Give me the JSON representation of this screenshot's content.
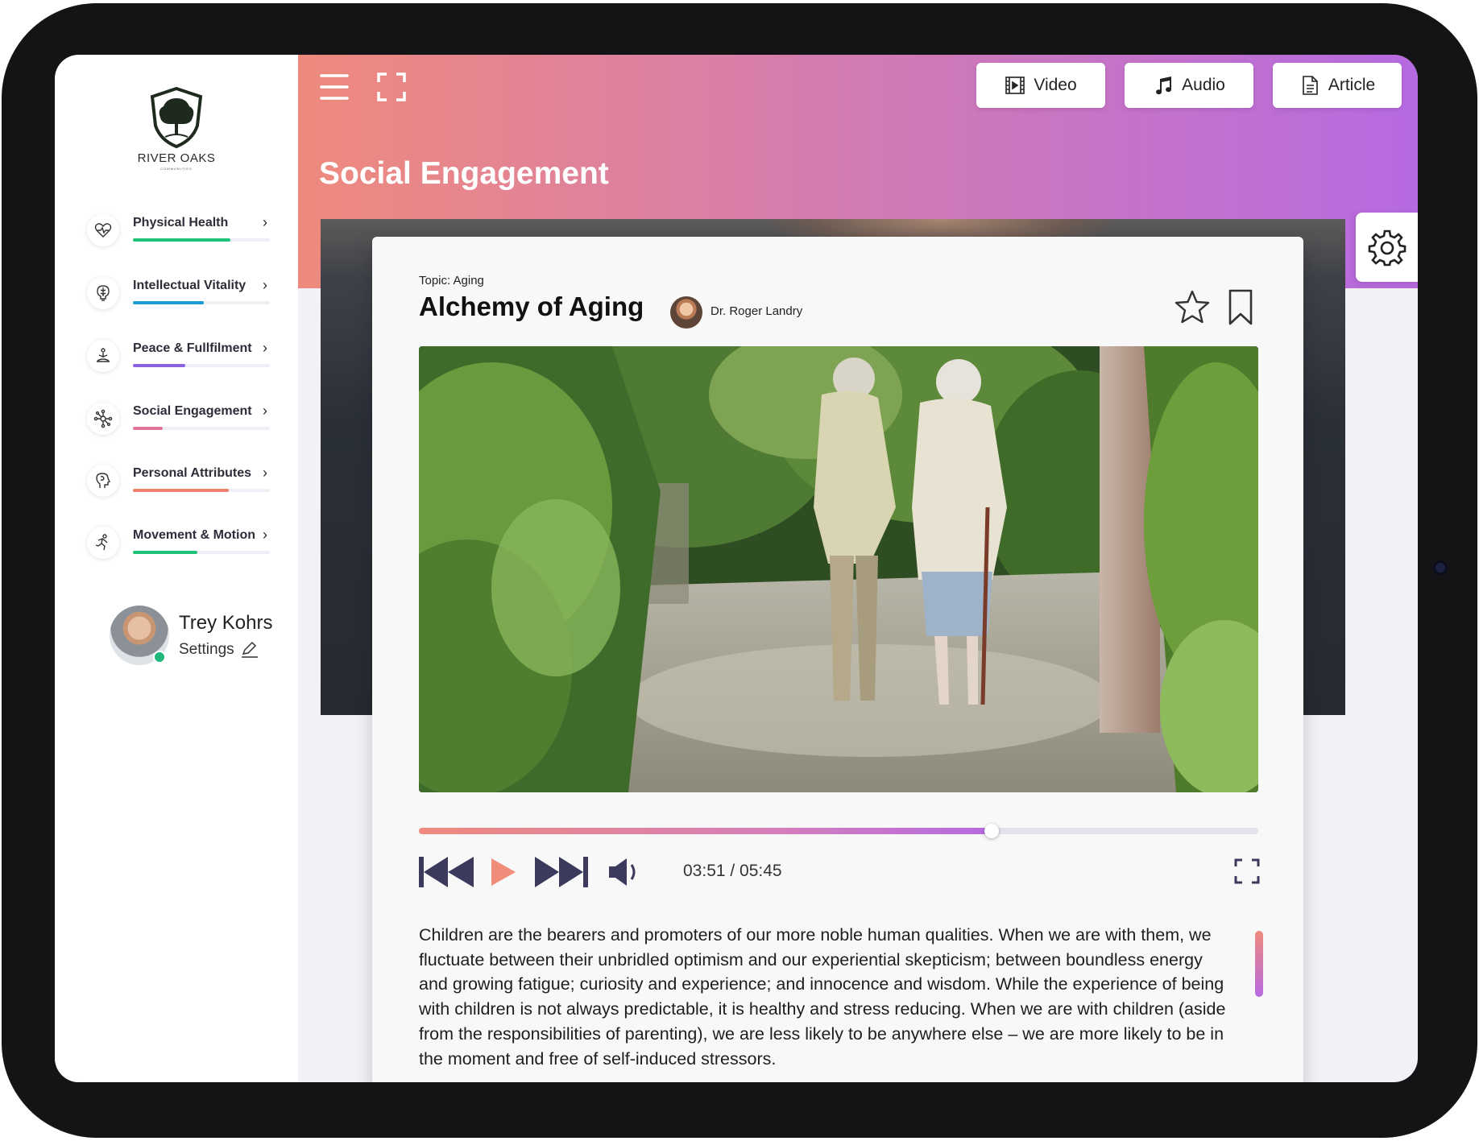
{
  "brand": {
    "name": "RIVER OAKS",
    "tagline": "COMMUNITIES"
  },
  "nav": [
    {
      "label": "Physical Health",
      "icon": "heart-pulse-icon",
      "color": "#1fc27a",
      "progress": 0.71
    },
    {
      "label": "Intellectual Vitality",
      "icon": "brain-bulb-icon",
      "color": "#1d9bd6",
      "progress": 0.52
    },
    {
      "label": "Peace & Fullfilment",
      "icon": "lotus-icon",
      "color": "#8a62e0",
      "progress": 0.38
    },
    {
      "label": "Social Engagement",
      "icon": "network-icon",
      "color": "#e27597",
      "progress": 0.22
    },
    {
      "label": "Personal Attributes",
      "icon": "head-profile-icon",
      "color": "#f07f6c",
      "progress": 0.7
    },
    {
      "label": "Movement & Motion",
      "icon": "running-person-icon",
      "color": "#1fc27a",
      "progress": 0.47
    }
  ],
  "user": {
    "name": "Trey Kohrs",
    "settings_label": "Settings",
    "status_color": "#22b77b"
  },
  "header": {
    "title": "Social Engagement",
    "buttons": {
      "video": "Video",
      "audio": "Audio",
      "article": "Article"
    }
  },
  "article": {
    "topic": "Topic: Aging",
    "title": "Alchemy of Aging",
    "author": "Dr. Roger Landry",
    "body": "Children are the bearers and promoters of our more noble human qualities. When we are with them, we fluctuate between their unbridled optimism and our experiential skepticism; between boundless energy and growing fatigue; curiosity and experience; and innocence and wisdom. While the experience of being with children is not always predictable, it is healthy and stress reducing. When we are with children (aside from the responsibilities of parenting), we are less likely to be anywhere else – we are more likely to be in the moment and free of self-induced stressors."
  },
  "player": {
    "time": "03:51 / 05:45",
    "progress": 0.682,
    "accent": "#ef8c7a",
    "control_color": "#3b3a5c"
  }
}
